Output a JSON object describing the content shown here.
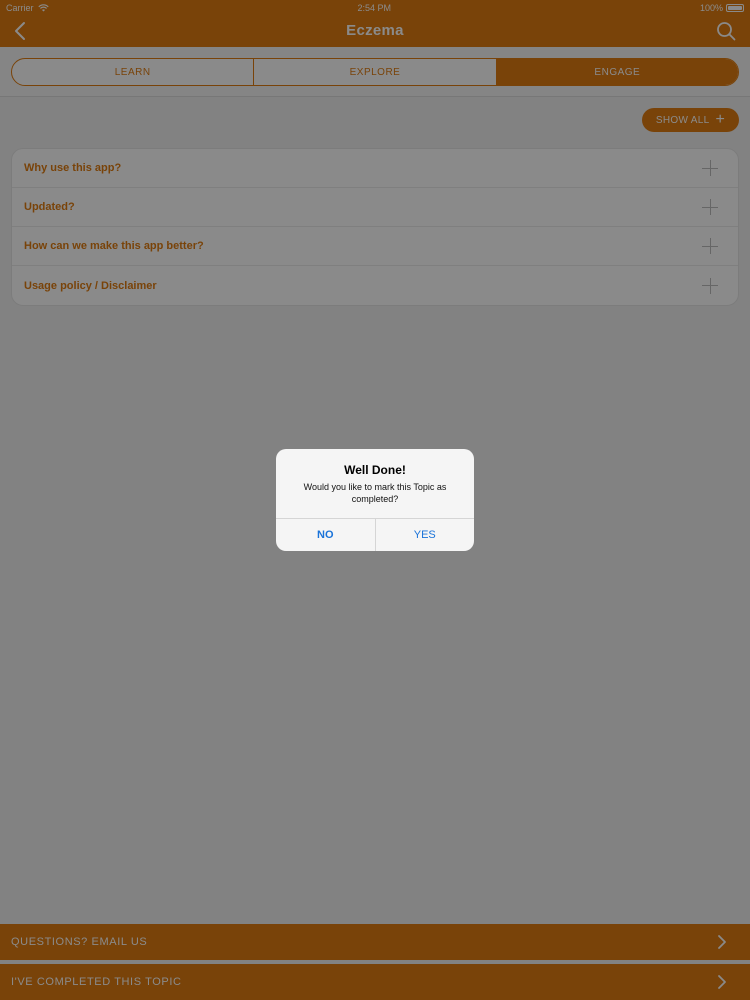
{
  "status_bar": {
    "carrier": "Carrier",
    "time": "2:54 PM",
    "battery": "100%"
  },
  "nav": {
    "title": "Eczema",
    "back_icon": "chevron-left-icon",
    "search_icon": "search-icon"
  },
  "segments": [
    {
      "label": "LEARN",
      "active": false
    },
    {
      "label": "EXPLORE",
      "active": false
    },
    {
      "label": "ENGAGE",
      "active": true
    }
  ],
  "show_all": {
    "label": "SHOW ALL",
    "icon": "plus-icon"
  },
  "accordion": {
    "items": [
      {
        "label": "Why use this app?"
      },
      {
        "label": "Updated?"
      },
      {
        "label": "How can we make this app better?"
      },
      {
        "label": "Usage policy / Disclaimer"
      }
    ]
  },
  "bottom_bars": {
    "email": {
      "label": "QUESTIONS? EMAIL US"
    },
    "completed": {
      "label": "I'VE COMPLETED THIS TOPIC"
    }
  },
  "alert": {
    "title": "Well Done!",
    "message": "Would you like to mark this Topic as completed?",
    "no_label": "NO",
    "yes_label": "YES"
  },
  "colors": {
    "accent": "#e07d12",
    "alert_button": "#1a73d9"
  }
}
